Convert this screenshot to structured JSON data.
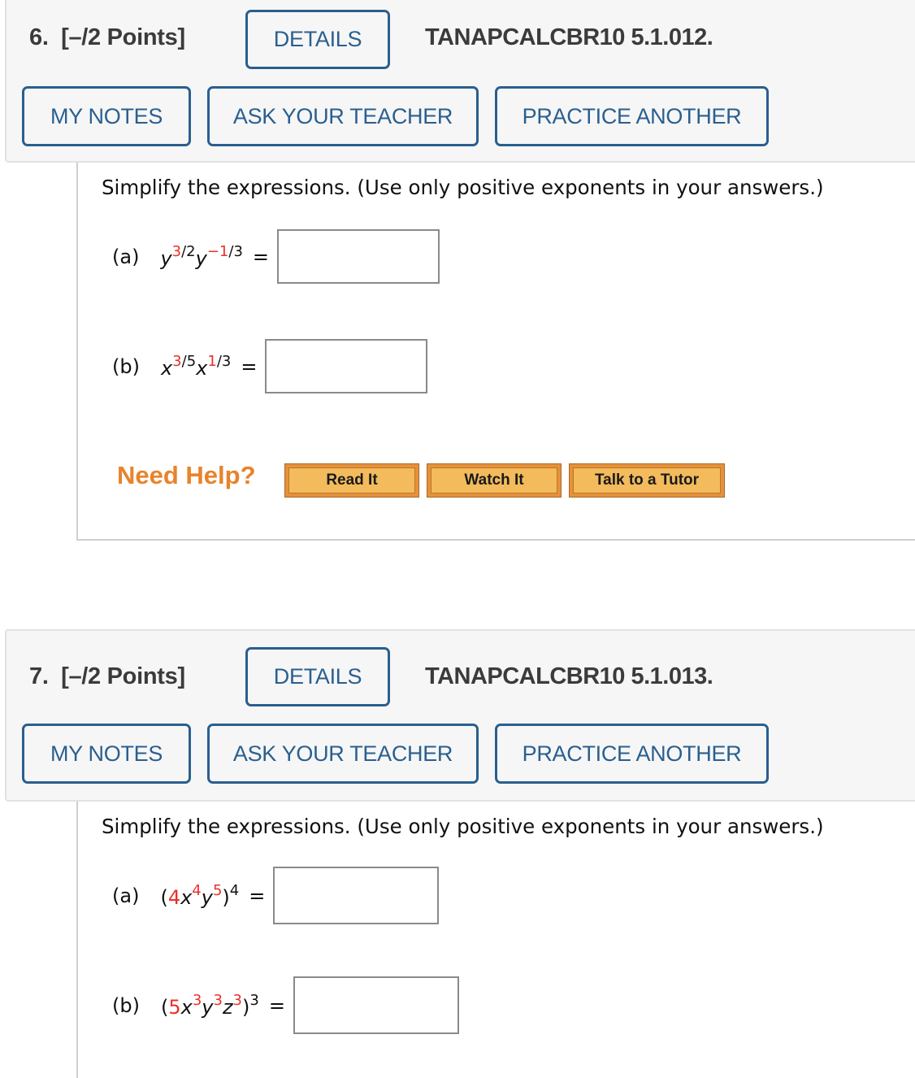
{
  "questions": [
    {
      "number_label": "6.",
      "points_label": "[–/2 Points]",
      "details_label": "DETAILS",
      "code": "TANAPCALCBR10 5.1.012.",
      "my_notes_label": "MY NOTES",
      "ask_teacher_label": "ASK YOUR TEACHER",
      "practice_label": "PRACTICE ANOTHER",
      "instructions": "Simplify the expressions. (Use only positive exponents in your answers.)",
      "parts": [
        {
          "label": "(a)",
          "base1": "y",
          "exp1_num": "3",
          "exp1_den": "/2",
          "base2": "y",
          "exp2_num": "−1",
          "exp2_den": "/3",
          "equals": "=",
          "answer_value": ""
        },
        {
          "label": "(b)",
          "base1": "x",
          "exp1_num": "3",
          "exp1_den": "/5",
          "base2": "x",
          "exp2_num": "1",
          "exp2_den": "/3",
          "equals": "=",
          "answer_value": ""
        }
      ],
      "need_help": {
        "label": "Need Help?",
        "buttons": [
          "Read It",
          "Watch It",
          "Talk to a Tutor"
        ]
      }
    },
    {
      "number_label": "7.",
      "points_label": "[–/2 Points]",
      "details_label": "DETAILS",
      "code": "TANAPCALCBR10 5.1.013.",
      "my_notes_label": "MY NOTES",
      "ask_teacher_label": "ASK YOUR TEACHER",
      "practice_label": "PRACTICE ANOTHER",
      "instructions": "Simplify the expressions. (Use only positive exponents in your answers.)",
      "parts": [
        {
          "label": "(a)",
          "open": "(",
          "coef": "4",
          "v1": "x",
          "e1": "4",
          "v2": "y",
          "e2": "5",
          "close": ")",
          "outer_exp": "4",
          "equals": "=",
          "answer_value": ""
        },
        {
          "label": "(b)",
          "open": "(",
          "coef": "5",
          "v1": "x",
          "e1": "3",
          "v2": "y",
          "e2": "3",
          "v3": "z",
          "e3": "3",
          "close": ")",
          "outer_exp": "3",
          "equals": "=",
          "answer_value": ""
        }
      ]
    }
  ],
  "colors": {
    "button_blue": "#2a5f8f",
    "highlight_red": "#e8312a",
    "need_help_orange": "#e8832a",
    "help_button_fill": "#f3bb5c"
  }
}
